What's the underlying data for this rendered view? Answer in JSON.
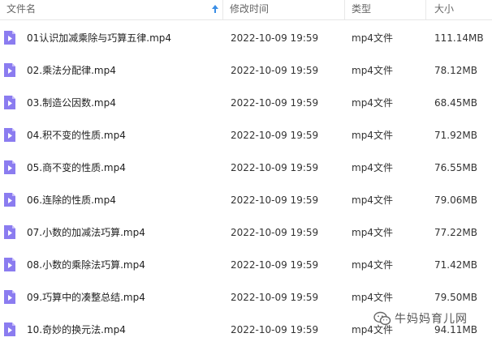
{
  "header": {
    "name": "文件名",
    "modified": "修改时间",
    "type": "类型",
    "size": "大小"
  },
  "files": [
    {
      "name": "01认识加减乘除与巧算五律.mp4",
      "date": "2022-10-09 19:59",
      "type": "mp4文件",
      "size": "111.14MB"
    },
    {
      "name": "02.乘法分配律.mp4",
      "date": "2022-10-09 19:59",
      "type": "mp4文件",
      "size": "78.12MB"
    },
    {
      "name": "03.制造公因数.mp4",
      "date": "2022-10-09 19:59",
      "type": "mp4文件",
      "size": "68.45MB"
    },
    {
      "name": "04.积不变的性质.mp4",
      "date": "2022-10-09 19:59",
      "type": "mp4文件",
      "size": "71.92MB"
    },
    {
      "name": "05.商不变的性质.mp4",
      "date": "2022-10-09 19:59",
      "type": "mp4文件",
      "size": "76.55MB"
    },
    {
      "name": "06.连除的性质.mp4",
      "date": "2022-10-09 19:59",
      "type": "mp4文件",
      "size": "79.06MB"
    },
    {
      "name": "07.小数的加减法巧算.mp4",
      "date": "2022-10-09 19:59",
      "type": "mp4文件",
      "size": "77.22MB"
    },
    {
      "name": "08.小数的乘除法巧算.mp4",
      "date": "2022-10-09 19:59",
      "type": "mp4文件",
      "size": "71.42MB"
    },
    {
      "name": "09.巧算中的凑整总结.mp4",
      "date": "2022-10-09 19:59",
      "type": "mp4文件",
      "size": "79.50MB"
    },
    {
      "name": "10.奇妙的换元法.mp4",
      "date": "2022-10-09 19:59",
      "type": "mp4文件",
      "size": "94.11MB"
    }
  ],
  "watermark": {
    "text": "牛妈妈育儿网"
  },
  "colors": {
    "file_icon": "#8b7cf0",
    "file_icon_fold": "#c8bffa"
  }
}
